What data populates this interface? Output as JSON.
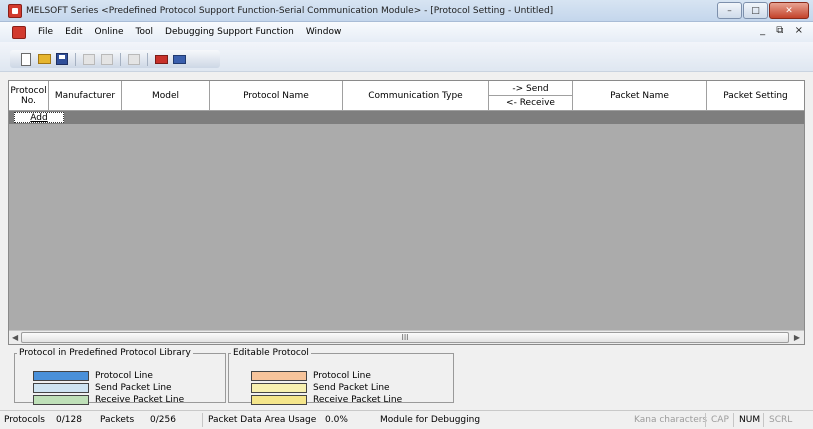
{
  "window": {
    "title": "MELSOFT Series <Predefined Protocol Support Function-Serial Communication Module> - [Protocol Setting - Untitled]",
    "controls": {
      "minimize": "–",
      "maximize": "□",
      "close": "✕"
    }
  },
  "menu": {
    "items": [
      "File",
      "Edit",
      "Online",
      "Tool",
      "Debugging Support Function",
      "Window"
    ],
    "mdi_controls": "_ ⧉ ×"
  },
  "toolbar": {
    "icons": [
      "new-icon",
      "open-icon",
      "save-icon",
      "cut-icon",
      "copy-icon",
      "paste-icon",
      "read-from-module-icon",
      "write-to-module-icon"
    ]
  },
  "grid": {
    "headers": {
      "protocol_no": "Protocol No.",
      "manufacturer": "Manufacturer",
      "model": "Model",
      "protocol_name": "Protocol Name",
      "communication_type": "Communication Type",
      "send": "-> Send",
      "receive": "<- Receive",
      "packet_name": "Packet Name",
      "packet_setting": "Packet Setting"
    },
    "add_label": "Add",
    "scroll_grip": "III"
  },
  "legend": {
    "library": {
      "title": "Protocol in Predefined Protocol Library",
      "items": [
        {
          "label": "Protocol Line",
          "color": "#4a90d9"
        },
        {
          "label": "Send Packet Line",
          "color": "#cfe4f2"
        },
        {
          "label": "Receive Packet Line",
          "color": "#bfe0b8"
        }
      ]
    },
    "editable": {
      "title": "Editable Protocol",
      "items": [
        {
          "label": "Protocol Line",
          "color": "#f7c49b"
        },
        {
          "label": "Send Packet Line",
          "color": "#f7f0b0"
        },
        {
          "label": "Receive Packet Line",
          "color": "#f4e58a"
        }
      ]
    }
  },
  "status": {
    "protocols_label": "Protocols",
    "protocols_value": "0/128",
    "packets_label": "Packets",
    "packets_value": "0/256",
    "packet_area_label": "Packet Data Area Usage",
    "packet_area_value": "0.0%",
    "module": "Module for Debugging",
    "kana": "Kana characters",
    "cap": "CAP",
    "num": "NUM",
    "scrl": "SCRL"
  }
}
